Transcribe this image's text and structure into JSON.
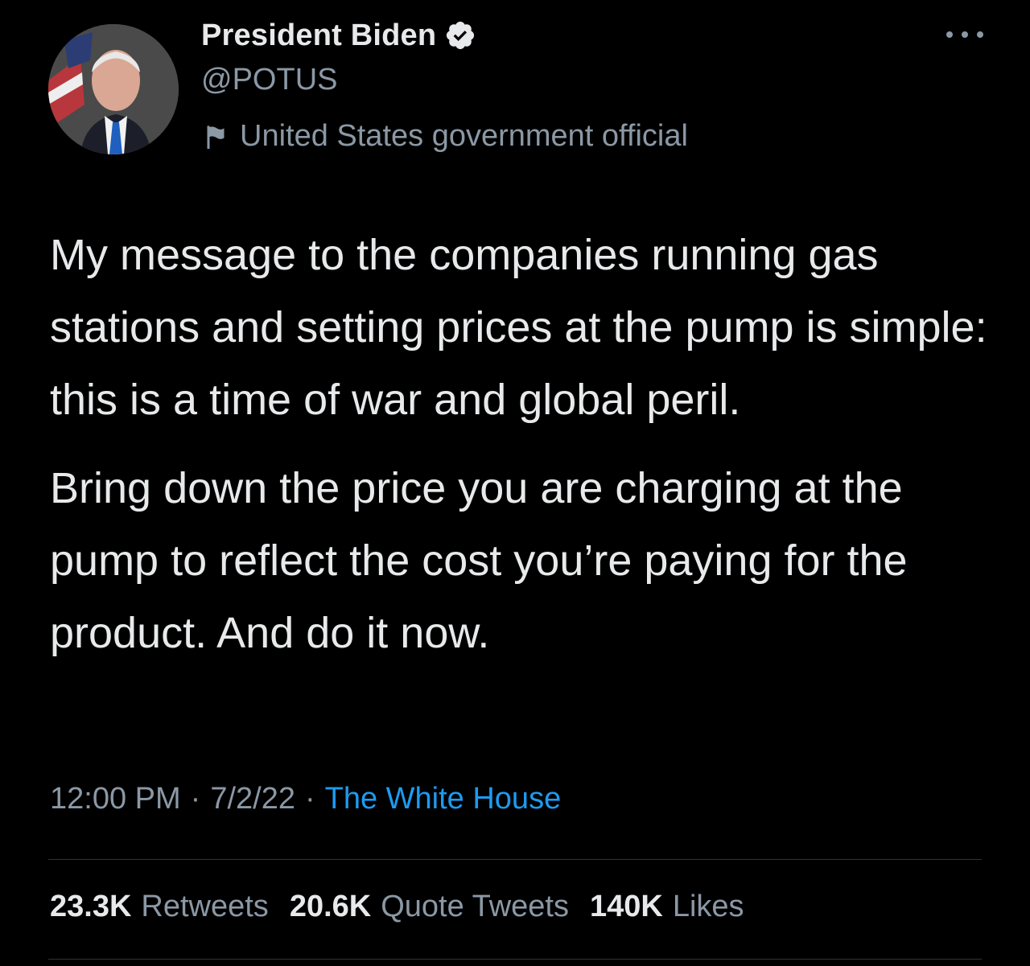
{
  "author": {
    "display_name": "President Biden",
    "handle": "@POTUS",
    "label": "United States government official"
  },
  "tweet": {
    "paragraphs": [
      "My message to the companies running gas stations and setting prices at the pump is simple: this is a time of war and global peril.",
      "Bring down the price you are charging at the pump to reflect the cost you’re paying for the product. And do it now."
    ],
    "time": "12:00 PM",
    "date": "7/2/22",
    "separator": "·",
    "source": "The White House"
  },
  "stats": {
    "retweets_count": "23.3K",
    "retweets_label": "Retweets",
    "quotes_count": "20.6K",
    "quotes_label": "Quote Tweets",
    "likes_count": "140K",
    "likes_label": "Likes"
  },
  "colors": {
    "background": "#000000",
    "text_primary": "#e7e9ea",
    "text_secondary": "#8b98a5",
    "link": "#1d9bf0",
    "divider": "#2f3336"
  },
  "icons": {
    "verified": "verified-badge-icon",
    "label": "flag-icon",
    "more": "more-options-icon"
  }
}
